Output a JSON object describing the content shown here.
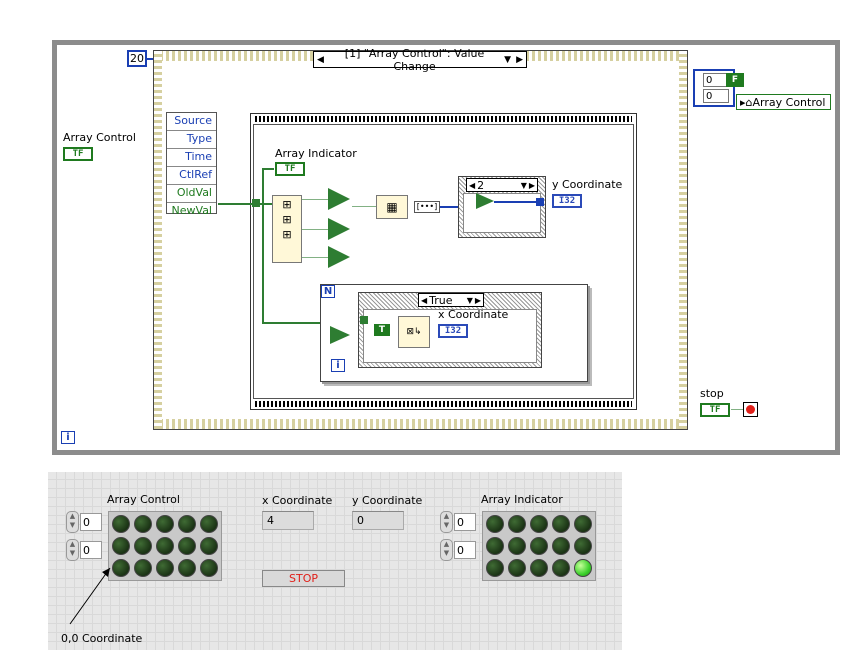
{
  "block_diagram": {
    "loop_count": "20",
    "event_case": "[1] \"Array Control\": Value Change",
    "event_data_items": [
      "Source",
      "Type",
      "Time",
      "CtlRef",
      "OldVal",
      "NewVal"
    ],
    "array_control_label": "Array Control",
    "array_control_term": "TF",
    "array_indicator_label": "Array Indicator",
    "array_indicator_term": "TF",
    "index_const": "2",
    "y_coord_label": "y Coordinate",
    "y_coord_term": "I32",
    "loop_N": "N",
    "loop_i": "i",
    "case_selector": "True",
    "x_coord_label": "x Coordinate",
    "x_coord_term": "I32",
    "true_const": "T",
    "init_array_vals": [
      "0",
      "0"
    ],
    "false_const": "F",
    "prop_node_label": "Array Control",
    "stop_label": "stop",
    "stop_term": "TF",
    "while_i": "i"
  },
  "front_panel": {
    "array_control": {
      "label": "Array Control",
      "index_row": "0",
      "index_col": "0",
      "leds_on": []
    },
    "x_coordinate": {
      "label": "x Coordinate",
      "value": "4"
    },
    "y_coordinate": {
      "label": "y Coordinate",
      "value": "0"
    },
    "array_indicator": {
      "label": "Array Indicator",
      "index_row": "0",
      "index_col": "0",
      "leds_on": [
        14
      ]
    },
    "stop_button": "STOP",
    "annotation": "0,0 Coordinate"
  },
  "colors": {
    "boolean_wire": "#2e7d32",
    "integer_wire": "#1a3fb3",
    "led_on": "#3bd02b",
    "led_off": "#1b3315",
    "stop_text": "#e0201a"
  }
}
